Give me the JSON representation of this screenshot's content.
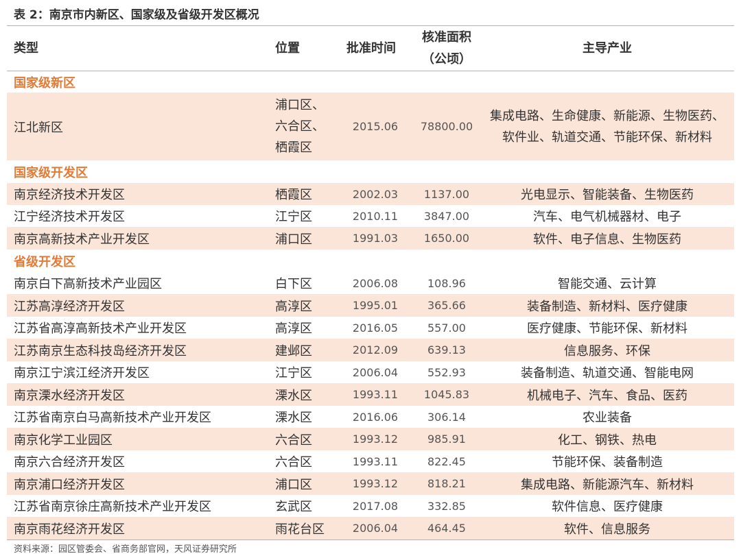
{
  "title": "表 2：南京市内新区、国家级及省级开发区概况",
  "headers": {
    "type": "类型",
    "location": "位置",
    "approval_time": "批准时间",
    "approved_area_line1": "核准面积",
    "approved_area_line2": "（公顷）",
    "industry": "主导产业"
  },
  "sections": [
    {
      "label": "国家级新区",
      "rows": [
        {
          "name": "江北新区",
          "location_lines": [
            "浦口区、",
            "六合区、",
            "栖霞区"
          ],
          "date": "2015.06",
          "area": "78800.00",
          "industry_lines": [
            "集成电路、生命健康、新能源、生物医药、",
            "软件业、轨道交通、节能环保、新材料"
          ]
        }
      ]
    },
    {
      "label": "国家级开发区",
      "rows": [
        {
          "name": "南京经济技术开发区",
          "location": "栖霞区",
          "date": "2002.03",
          "area": "1137.00",
          "industry": "光电显示、智能装备、生物医药"
        },
        {
          "name": "江宁经济技术开发区",
          "location": "江宁区",
          "date": "2010.11",
          "area": "3847.00",
          "industry": "汽车、电气机械器材、电子"
        },
        {
          "name": "南京高新技术产业开发区",
          "location": "浦口区",
          "date": "1991.03",
          "area": "1650.00",
          "industry": "软件、电子信息、生物医药"
        }
      ]
    },
    {
      "label": "省级开发区",
      "rows": [
        {
          "name": "南京白下高新技术产业园区",
          "location": "白下区",
          "date": "2006.08",
          "area": "108.96",
          "industry": "智能交通、云计算"
        },
        {
          "name": "江苏高淳经济开发区",
          "location": "高淳区",
          "date": "1995.01",
          "area": "365.66",
          "industry": "装备制造、新材料、医疗健康"
        },
        {
          "name": "江苏省高淳高新技术产业开发区",
          "location": "高淳区",
          "date": "2016.05",
          "area": "557.00",
          "industry": "医疗健康、节能环保、新材料"
        },
        {
          "name": "江苏南京生态科技岛经济开发区",
          "location": "建邺区",
          "date": "2012.09",
          "area": "639.13",
          "industry": "信息服务、环保"
        },
        {
          "name": "南京江宁滨江经济开发区",
          "location": "江宁区",
          "date": "2006.04",
          "area": "552.93",
          "industry": "装备制造、轨道交通、智能电网"
        },
        {
          "name": "南京溧水经济开发区",
          "location": "溧水区",
          "date": "1993.11",
          "area": "1045.83",
          "industry": "机械电子、汽车、食品、医药"
        },
        {
          "name": "江苏省南京白马高新技术产业开发区",
          "location": "溧水区",
          "date": "2016.06",
          "area": "306.14",
          "industry": "农业装备"
        },
        {
          "name": "南京化学工业园区",
          "location": "六合区",
          "date": "1993.12",
          "area": "985.91",
          "industry": "化工、钢铁、热电"
        },
        {
          "name": "南京六合经济开发区",
          "location": "六合区",
          "date": "1993.11",
          "area": "822.45",
          "industry": "节能环保、装备制造"
        },
        {
          "name": "南京浦口经济开发区",
          "location": "浦口区",
          "date": "1993.12",
          "area": "818.21",
          "industry": "集成电路、新能源汽车、新材料"
        },
        {
          "name": "江苏省南京徐庄高新技术产业开发区",
          "location": "玄武区",
          "date": "2017.08",
          "area": "332.85",
          "industry": "软件信息、医疗健康"
        },
        {
          "name": "南京雨花经济开发区",
          "location": "雨花台区",
          "date": "2006.04",
          "area": "464.45",
          "industry": "软件、信息服务"
        }
      ]
    }
  ],
  "source": "资料来源：园区管委会、省商务部官网，天风证券研究所",
  "colors": {
    "accent": "#e07b38",
    "row_shade": "#fbe5d9",
    "rule": "#e0a672"
  }
}
